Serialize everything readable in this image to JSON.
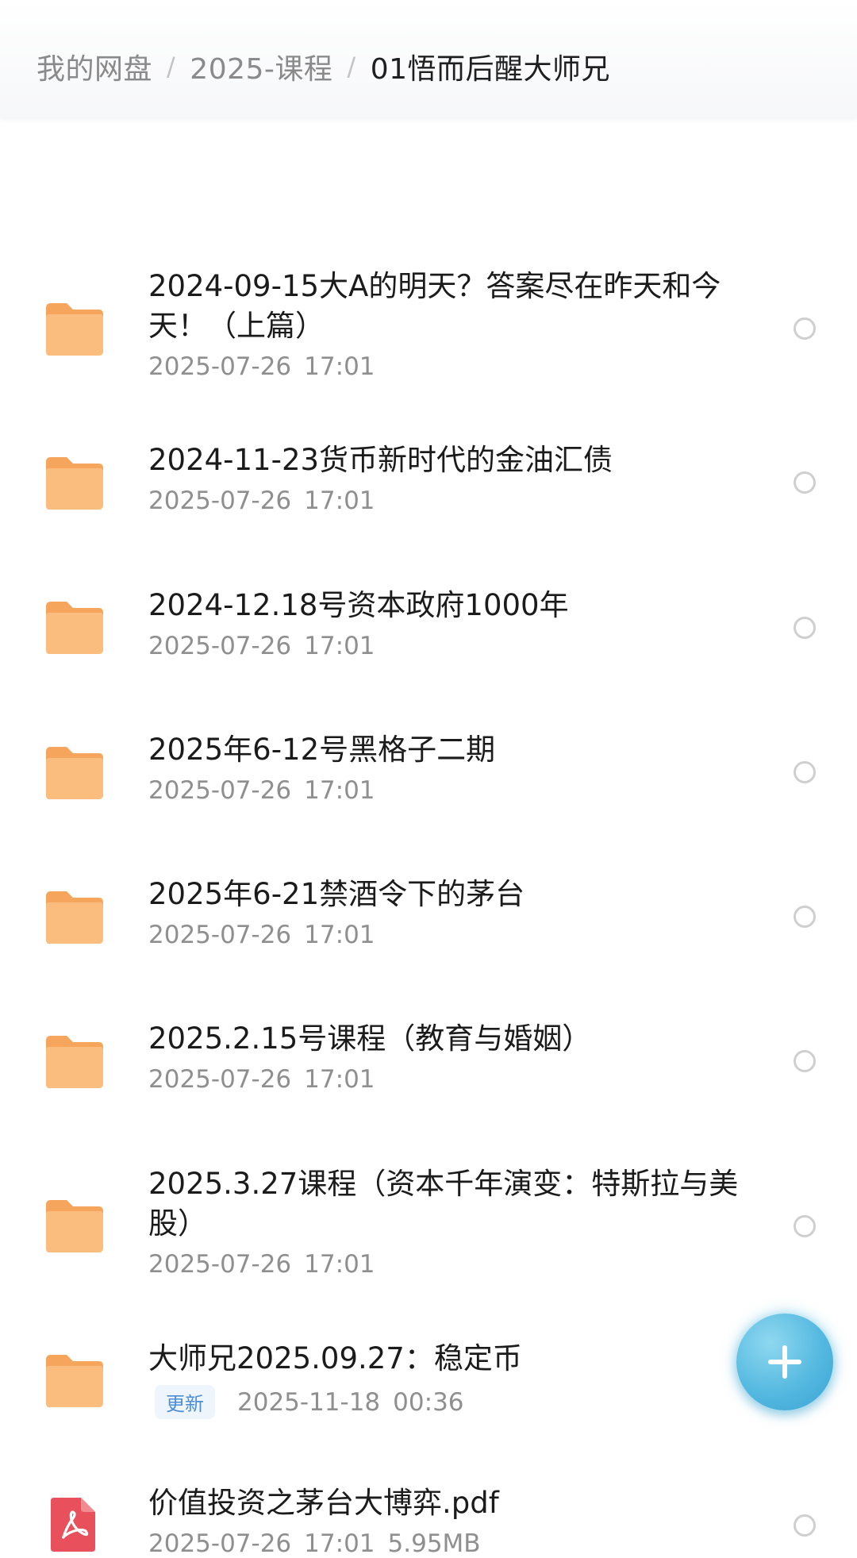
{
  "breadcrumb": {
    "root": "我的网盘",
    "level1": "2025-课程",
    "current": "01悟而后醒大师兄",
    "separator": "/"
  },
  "files": [
    {
      "type": "folder",
      "name": "2024-09-15大A的明天？答案尽在昨天和今天！（上篇）",
      "date": "2025-07-26",
      "time": "17:01"
    },
    {
      "type": "folder",
      "name": "2024-11-23货币新时代的金油汇债",
      "date": "2025-07-26",
      "time": "17:01"
    },
    {
      "type": "folder",
      "name": "2024-12.18号资本政府1000年",
      "date": "2025-07-26",
      "time": "17:01"
    },
    {
      "type": "folder",
      "name": "2025年6-12号黑格子二期",
      "date": "2025-07-26",
      "time": "17:01"
    },
    {
      "type": "folder",
      "name": "2025年6-21禁酒令下的茅台",
      "date": "2025-07-26",
      "time": "17:01"
    },
    {
      "type": "folder",
      "name": "2025.2.15号课程（教育与婚姻）",
      "date": "2025-07-26",
      "time": "17:01"
    },
    {
      "type": "folder",
      "name": "2025.3.27课程（资本千年演变：特斯拉与美股）",
      "date": "2025-07-26",
      "time": "17:01"
    },
    {
      "type": "folder",
      "name": "大师兄2025.09.27：稳定币",
      "badge": "更新",
      "date": "2025-11-18",
      "time": "00:36"
    },
    {
      "type": "pdf",
      "name": "价值投资之茅台大博弈.pdf",
      "date": "2025-07-26",
      "time": "17:01",
      "size": "5.95MB"
    }
  ],
  "colors": {
    "folder": "#F9B36E",
    "pdf": "#E8505B",
    "fab": "#55B9E0",
    "badge_text": "#4B8FD6"
  },
  "icons": {
    "folder": "folder-icon",
    "pdf": "pdf-icon",
    "fab": "plus-icon",
    "select": "radio-circle-icon"
  }
}
